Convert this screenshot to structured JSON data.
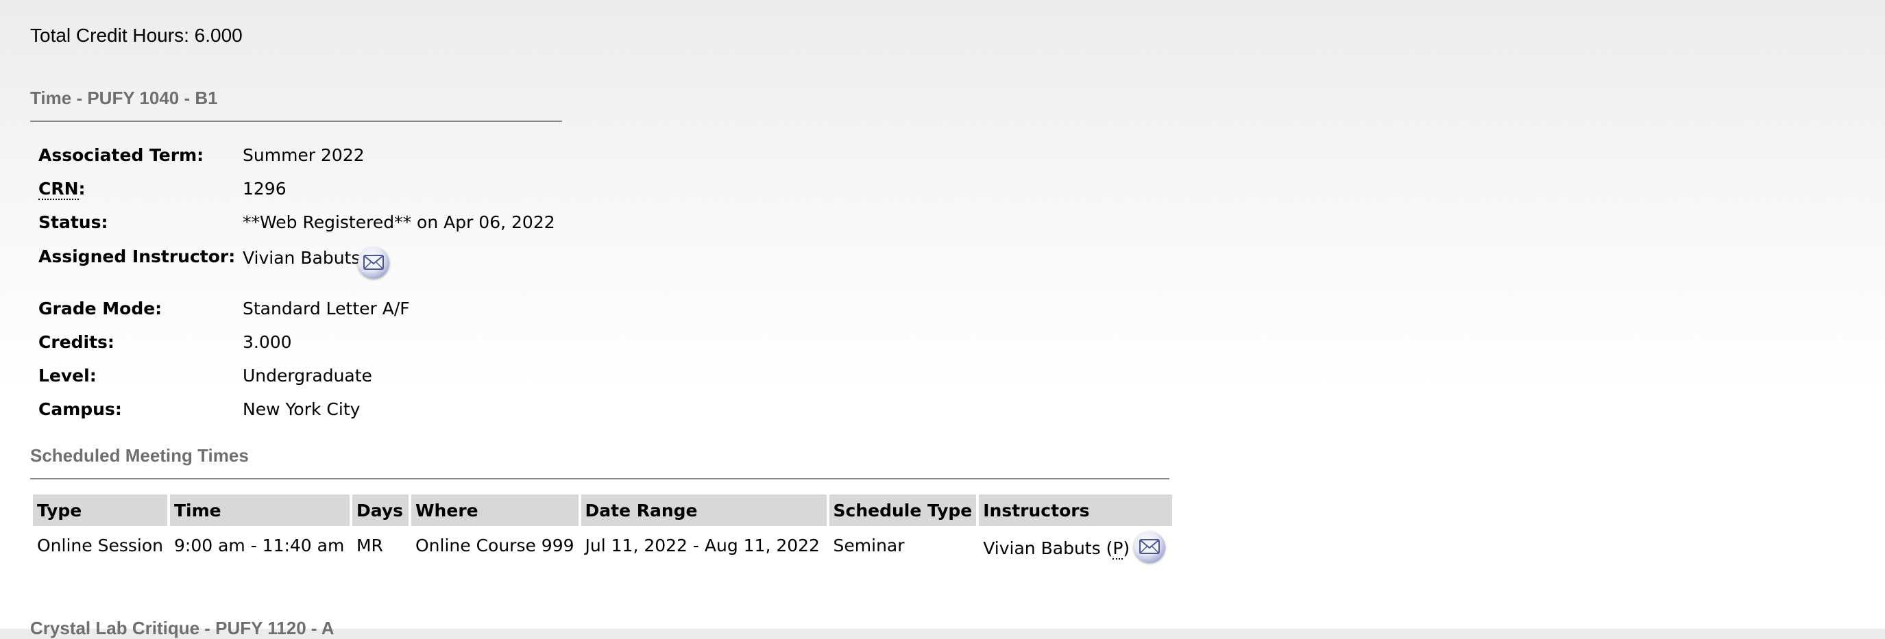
{
  "total_credit_hours": "Total Credit Hours: 6.000",
  "course_section": {
    "title": "Time - PUFY 1040 - B1",
    "rows": [
      {
        "label": "Associated Term:",
        "value": "Summer 2022"
      },
      {
        "label": "CRN",
        "label_suffix": ":",
        "value": "1296"
      },
      {
        "label": "Status:",
        "value": "**Web Registered** on Apr 06, 2022"
      },
      {
        "label": "Assigned Instructor:",
        "value": "Vivian Babuts"
      },
      {
        "label": "Grade Mode:",
        "value": "Standard Letter A/F"
      },
      {
        "label": "Credits:",
        "value": "3.000"
      },
      {
        "label": "Level:",
        "value": "Undergraduate"
      },
      {
        "label": "Campus:",
        "value": "New York City"
      }
    ],
    "email_icon": "mail-envelope-icon"
  },
  "meeting_times": {
    "title": "Scheduled Meeting Times",
    "headers": [
      "Type",
      "Time",
      "Days",
      "Where",
      "Date Range",
      "Schedule Type",
      "Instructors"
    ],
    "row": {
      "type": "Online Session",
      "time": "9:00 am - 11:40 am",
      "days": "MR",
      "where": "Online Course 999",
      "date_range": "Jul 11, 2022 - Aug 11, 2022",
      "schedule_type": "Seminar",
      "instructor": "Vivian Babuts",
      "instructor_role_open": "(",
      "instructor_role": "P",
      "instructor_role_close": ")"
    }
  },
  "next_section_title_partial": "Crystal Lab Critique - PUFY 1120 - A"
}
